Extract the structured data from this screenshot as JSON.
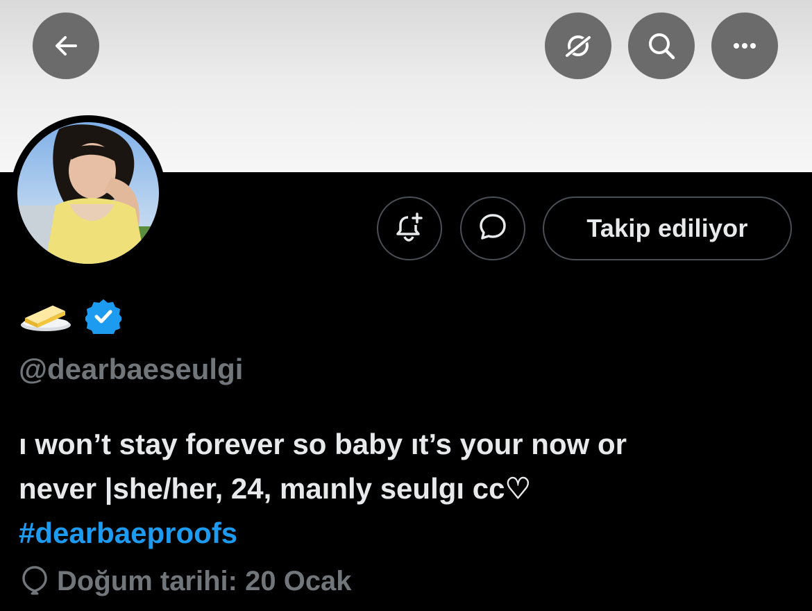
{
  "header": {
    "back_icon": "arrow-left-icon",
    "action_icons": [
      "mute-off-icon",
      "search-icon",
      "more-icon"
    ]
  },
  "profile": {
    "avatar_alt": "profile photo",
    "name_emoji": "🧈",
    "verified_color": "#1d9bf0",
    "handle": "@dearbaeseulgi",
    "bio_line1": "ı won’t stay forever so baby ıt’s your now or",
    "bio_line2": "never |she/her, 24, maınly seulgı cc♡",
    "bio_hashtag": "#dearbaeproofs",
    "birthday": "Doğum tarihi: 20 Ocak"
  },
  "actions": {
    "notify_icon": "bell-plus-icon",
    "message_icon": "message-bubble-icon",
    "follow_label": "Takip ediliyor"
  },
  "colors": {
    "background": "#000000",
    "text_primary": "#e7e9ea",
    "text_secondary": "#71767b",
    "accent": "#1d9bf0",
    "overlay_button": "#6b6b6b"
  }
}
